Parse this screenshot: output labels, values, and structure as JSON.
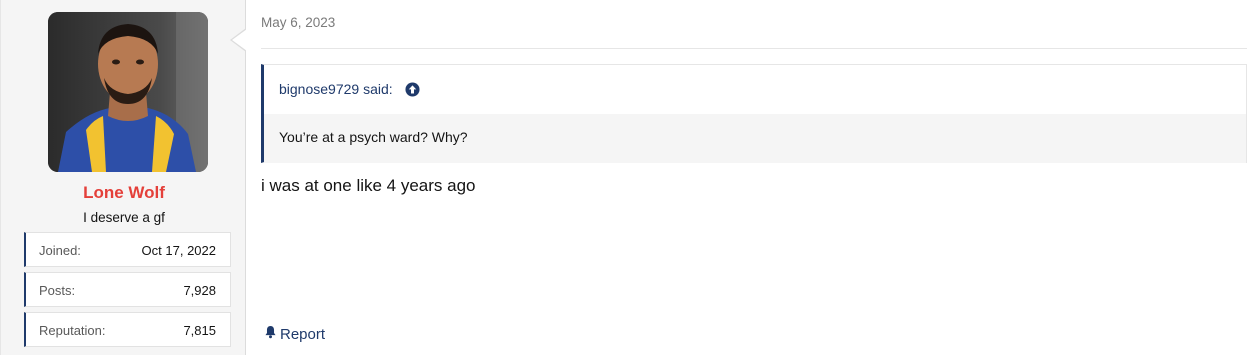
{
  "post": {
    "date": "May 6, 2023",
    "message": "i was at one like 4 years ago",
    "report_label": "Report"
  },
  "quote": {
    "author_said": "bignose9729 said:",
    "text": "You’re at a psych ward? Why?"
  },
  "user": {
    "name": "Lone Wolf",
    "title": "I deserve a gf",
    "stats": [
      {
        "label": "Joined:",
        "value": "Oct 17, 2022"
      },
      {
        "label": "Posts:",
        "value": "7,928"
      },
      {
        "label": "Reputation:",
        "value": "7,815"
      }
    ]
  },
  "colors": {
    "username": "#e4403a",
    "accent": "#1f3a6b"
  },
  "icons": {
    "quote_jump": "arrow-up-circle-icon",
    "report": "bell-icon"
  }
}
